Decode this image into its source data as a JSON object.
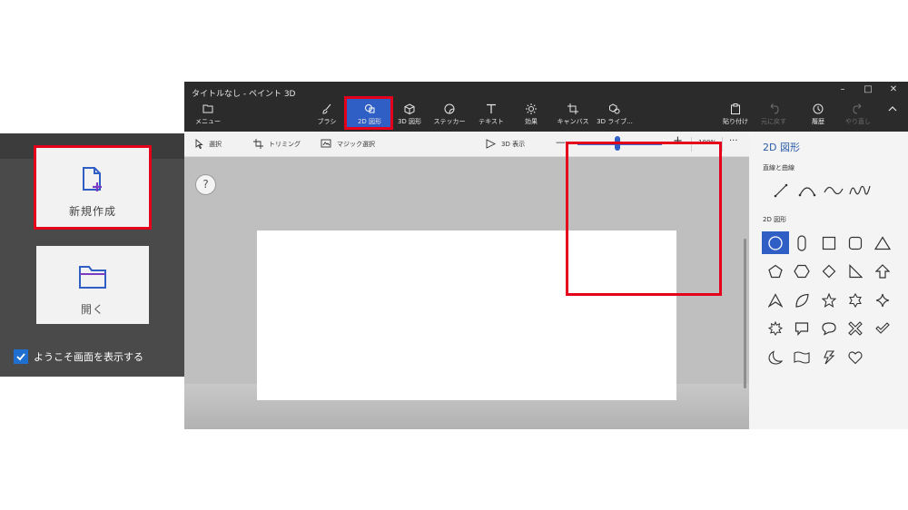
{
  "welcome": {
    "new_label": "新規作成",
    "open_label": "開く",
    "show_welcome_label": "ようこそ画面を表示する",
    "show_welcome_checked": true
  },
  "window": {
    "title": "タイトルなし - ペイント 3D",
    "controls": [
      "–",
      "□",
      "✕"
    ]
  },
  "toolbar": {
    "menu": "メニュー",
    "brush": "ブラシ",
    "shapes2d": "2D 図形",
    "shapes3d": "3D 図形",
    "stickers": "ステッカー",
    "text": "テキスト",
    "effects": "効果",
    "canvas": "キャンバス",
    "library3d": "3D ライブ...",
    "paste": "貼り付け",
    "undo": "元に戻す",
    "history": "履歴",
    "redo": "やり直し",
    "active_tool": "2D 図形"
  },
  "subtoolbar": {
    "select": "選択",
    "crop": "トリミング",
    "magic_select": "マジック選択",
    "view3d": "3D 表示",
    "zoom_minus": "—",
    "zoom_plus": "+",
    "zoom_level": "100%",
    "zoom_fraction": 0.47,
    "more": "···"
  },
  "canvas_area": {
    "help": "?"
  },
  "side_panel": {
    "title": "2D 図形",
    "lines_section": "直線と曲線",
    "lines": [
      "line-icon",
      "curve-icon",
      "two-point-curve-icon",
      "three-point-curve-icon"
    ],
    "shapes_section": "2D 図形",
    "shapes": [
      [
        "circle-icon",
        "capsule-icon",
        "square-icon",
        "rounded-square-icon",
        "triangle-icon"
      ],
      [
        "pentagon-icon",
        "hexagon-icon",
        "diamond-icon",
        "right-triangle-icon",
        "arrow-up-icon"
      ],
      [
        "arrowhead-icon",
        "leaf-icon",
        "star5-icon",
        "star6-icon",
        "star4-icon"
      ],
      [
        "burst-icon",
        "speech-rect-icon",
        "speech-oval-icon",
        "cross-icon",
        "check-icon"
      ],
      [
        "moon-icon",
        "banner-icon",
        "lightning-icon",
        "heart-icon"
      ]
    ],
    "selected_shape": "circle-icon"
  },
  "colors": {
    "accent": "#2f5ec4",
    "highlight": "#e4001b",
    "titlebar": "#2b2b2b"
  }
}
